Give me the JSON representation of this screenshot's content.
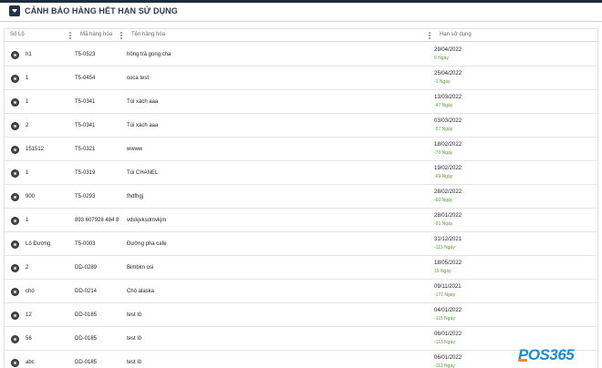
{
  "header": {
    "title": "CẢNH BÁO HÀNG HẾT HẠN SỬ DỤNG"
  },
  "table": {
    "columns": {
      "lot": "Số Lô",
      "code": "Mã hàng hóa",
      "name": "Tên hàng hóa",
      "expiry": "Hạn sử dụng"
    },
    "rows": [
      {
        "lot": "h1",
        "code": "T5-0523",
        "name": "hồng trà gong cha",
        "date": "29/04/2022",
        "days": "0 Ngày"
      },
      {
        "lot": "1",
        "code": "T5-0454",
        "name": "coca test",
        "date": "25/04/2022",
        "days": "-1 Ngày"
      },
      {
        "lot": "1",
        "code": "T5-0341",
        "name": "Túi xách aaa",
        "date": "13/03/2022",
        "days": "-47 Ngày"
      },
      {
        "lot": "2",
        "code": "T5-0341",
        "name": "Túi xách aaa",
        "date": "03/03/2022",
        "days": "-57 Ngày"
      },
      {
        "lot": "151512",
        "code": "T5-0321",
        "name": "wwww",
        "date": "18/02/2022",
        "days": "-70 Ngày"
      },
      {
        "lot": "1",
        "code": "T5-0319",
        "name": "Túi CHANEL",
        "date": "19/02/2022",
        "days": "-69 Ngày"
      },
      {
        "lot": "900",
        "code": "T5-0293",
        "name": "fhdfhgj",
        "date": "28/02/2022",
        "days": "-60 Ngày"
      },
      {
        "lot": "1",
        "code": "893 607928 484 8",
        "name": "vdskjvksdmvkjm",
        "date": "28/01/2022",
        "days": "-91 Ngày"
      },
      {
        "lot": "Lô Đường",
        "code": "T5-0003",
        "name": "Đường pha cafe",
        "date": "31/12/2021",
        "days": "-119 Ngày"
      },
      {
        "lot": "2",
        "code": "DD-0289",
        "name": "Bimbim osi",
        "date": "18/05/2022",
        "days": "19 Ngày"
      },
      {
        "lot": "chó",
        "code": "DD-0214",
        "name": "Chó alaska",
        "date": "09/11/2021",
        "days": "-171 Ngày"
      },
      {
        "lot": "12",
        "code": "DD-0185",
        "name": "test lô",
        "date": "04/01/2022",
        "days": "-115 Ngày"
      },
      {
        "lot": "56",
        "code": "DD-0185",
        "name": "test lô",
        "date": "06/01/2022",
        "days": "-113 Ngày"
      },
      {
        "lot": "abc",
        "code": "DD-0185",
        "name": "test lô",
        "date": "06/01/2022",
        "days": "-113 Ngày"
      }
    ]
  },
  "logo": {
    "text": "POS365"
  },
  "colors": {
    "accent": "#1e2b3a",
    "days_text": "#5a9a3c",
    "logo_blue": "#1c8ad6",
    "logo_orange": "#f08a24"
  }
}
